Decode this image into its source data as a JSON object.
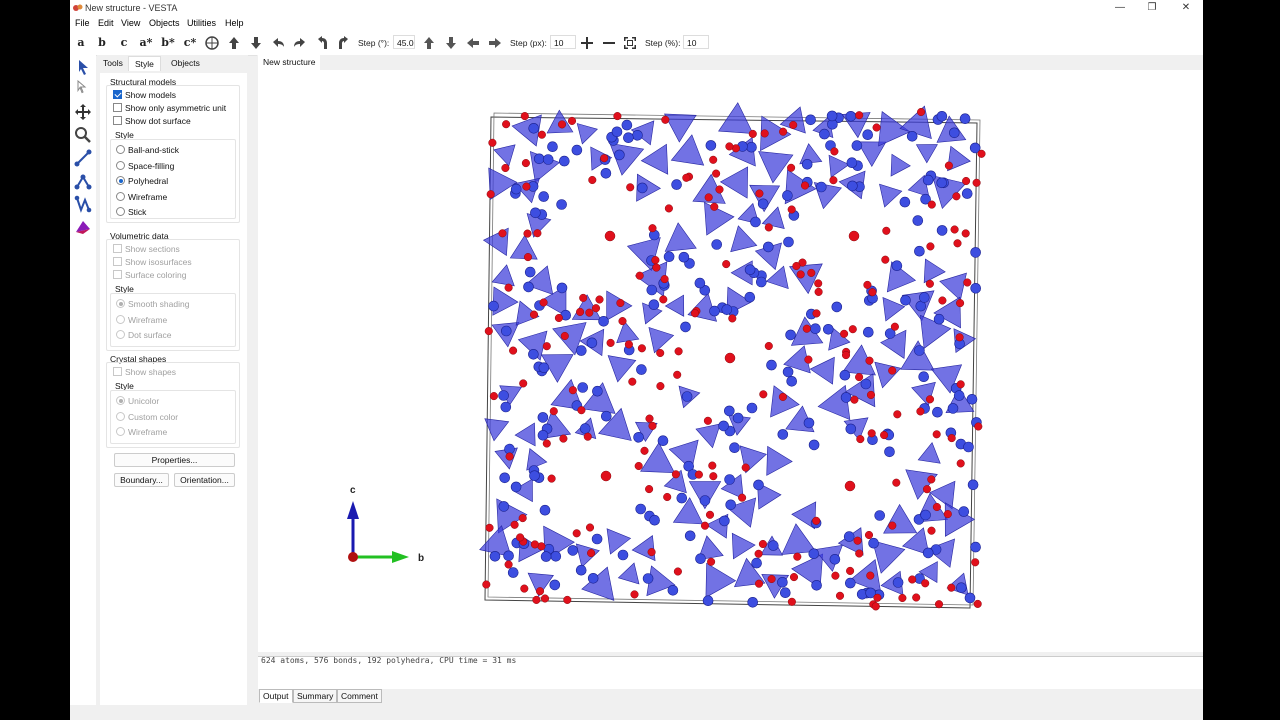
{
  "window": {
    "title": "New structure - VESTA"
  },
  "menu": [
    "File",
    "Edit",
    "View",
    "Objects",
    "Utilities",
    "Help"
  ],
  "toolbar": {
    "axis_buttons": [
      "a",
      "b",
      "c",
      "a*",
      "b*",
      "c*"
    ],
    "step_deg_label": "Step (°):",
    "step_deg_value": "45.0",
    "step_px_label": "Step (px):",
    "step_px_value": "10",
    "step_pct_label": "Step (%):",
    "step_pct_value": "10"
  },
  "panel": {
    "tabs": [
      "Tools",
      "Style",
      "Objects"
    ],
    "active_tab": "Style",
    "structural_models": {
      "title": "Structural models",
      "checks": [
        {
          "label": "Show models",
          "checked": true
        },
        {
          "label": "Show only asymmetric unit",
          "checked": false
        },
        {
          "label": "Show dot surface",
          "checked": false
        }
      ],
      "style_title": "Style",
      "styles": [
        {
          "label": "Ball-and-stick",
          "selected": false
        },
        {
          "label": "Space-filling",
          "selected": false
        },
        {
          "label": "Polyhedral",
          "selected": true
        },
        {
          "label": "Wireframe",
          "selected": false
        },
        {
          "label": "Stick",
          "selected": false
        }
      ]
    },
    "volumetric": {
      "title": "Volumetric data",
      "checks": [
        "Show sections",
        "Show isosurfaces",
        "Surface coloring"
      ],
      "style_title": "Style",
      "styles": [
        {
          "label": "Smooth shading",
          "selected": true
        },
        {
          "label": "Wireframe",
          "selected": false
        },
        {
          "label": "Dot surface",
          "selected": false
        }
      ]
    },
    "crystal": {
      "title": "Crystal shapes",
      "check": "Show shapes",
      "style_title": "Style",
      "styles": [
        {
          "label": "Unicolor",
          "selected": true
        },
        {
          "label": "Custom color",
          "selected": false
        },
        {
          "label": "Wireframe",
          "selected": false
        }
      ]
    },
    "buttons": {
      "properties": "Properties...",
      "boundary": "Boundary...",
      "orientation": "Orientation..."
    }
  },
  "document": {
    "tab": "New structure",
    "axes": {
      "c": "c",
      "b": "b"
    },
    "output_text": "624 atoms, 576 bonds, 192 polyhedra, CPU time = 31 ms",
    "output_tabs": [
      "Output",
      "Summary",
      "Comment"
    ]
  },
  "colors": {
    "polyhedra": "#3b3bd9",
    "oxygen": "#e0101c",
    "accent": "#1a66cc"
  }
}
